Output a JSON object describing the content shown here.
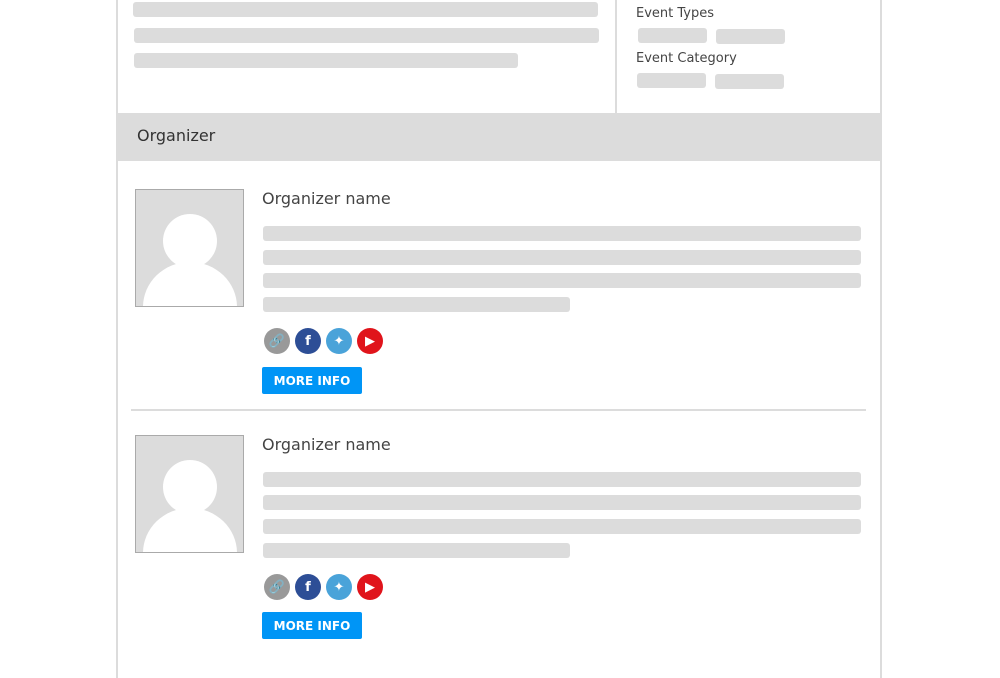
{
  "details": {
    "event_types_label": "Event Types",
    "event_category_label": "Event Category"
  },
  "section": {
    "title": "Organizer"
  },
  "organizers": [
    {
      "name": "Organizer name",
      "more_info_label": "MORE INFO"
    },
    {
      "name": "Organizer name",
      "more_info_label": "MORE INFO"
    }
  ],
  "social_icons": [
    {
      "name": "link",
      "color": "#999999"
    },
    {
      "name": "facebook",
      "color": "#2d4e96"
    },
    {
      "name": "twitter",
      "color": "#4aa3d9"
    },
    {
      "name": "youtube",
      "color": "#e0141b"
    }
  ],
  "colors": {
    "accent": "#0095f6",
    "skeleton": "#dcdcdc"
  }
}
